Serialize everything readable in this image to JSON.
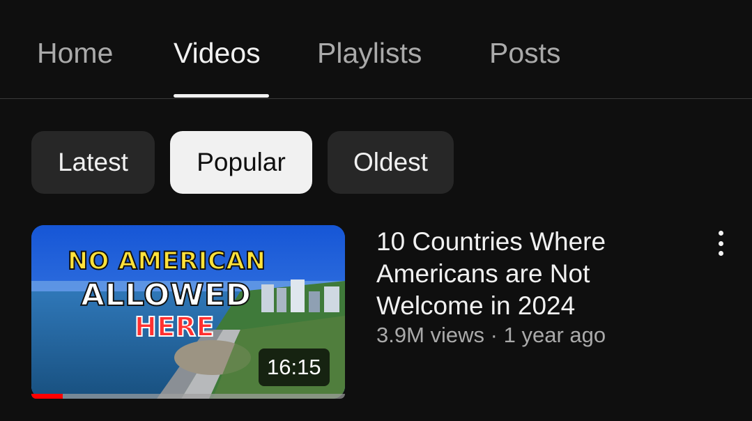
{
  "tabs": [
    {
      "label": "Home",
      "active": false
    },
    {
      "label": "Videos",
      "active": true
    },
    {
      "label": "Playlists",
      "active": false
    },
    {
      "label": "Posts",
      "active": false
    }
  ],
  "chips": [
    {
      "label": "Latest",
      "active": false
    },
    {
      "label": "Popular",
      "active": true
    },
    {
      "label": "Oldest",
      "active": false
    }
  ],
  "video": {
    "title": "10 Countries Where Americans are Not Welcome in 2024",
    "views": "3.9M views",
    "separator": "·",
    "age": "1 year ago",
    "duration": "16:15",
    "watch_progress_fraction": 0.1,
    "thumbnail_text": {
      "line1": "NO AMERICAN",
      "line2": "ALLOWED",
      "line3": "HERE"
    },
    "more_actions_icon": "vertical-ellipsis-icon"
  },
  "colors": {
    "background": "#0f0f0f",
    "chip_active": "#f1f1f1",
    "chip_inactive": "#272727",
    "progress": "#ff0000",
    "thumbnail_line1": "#ffe23a",
    "thumbnail_line3": "#ff3030"
  }
}
